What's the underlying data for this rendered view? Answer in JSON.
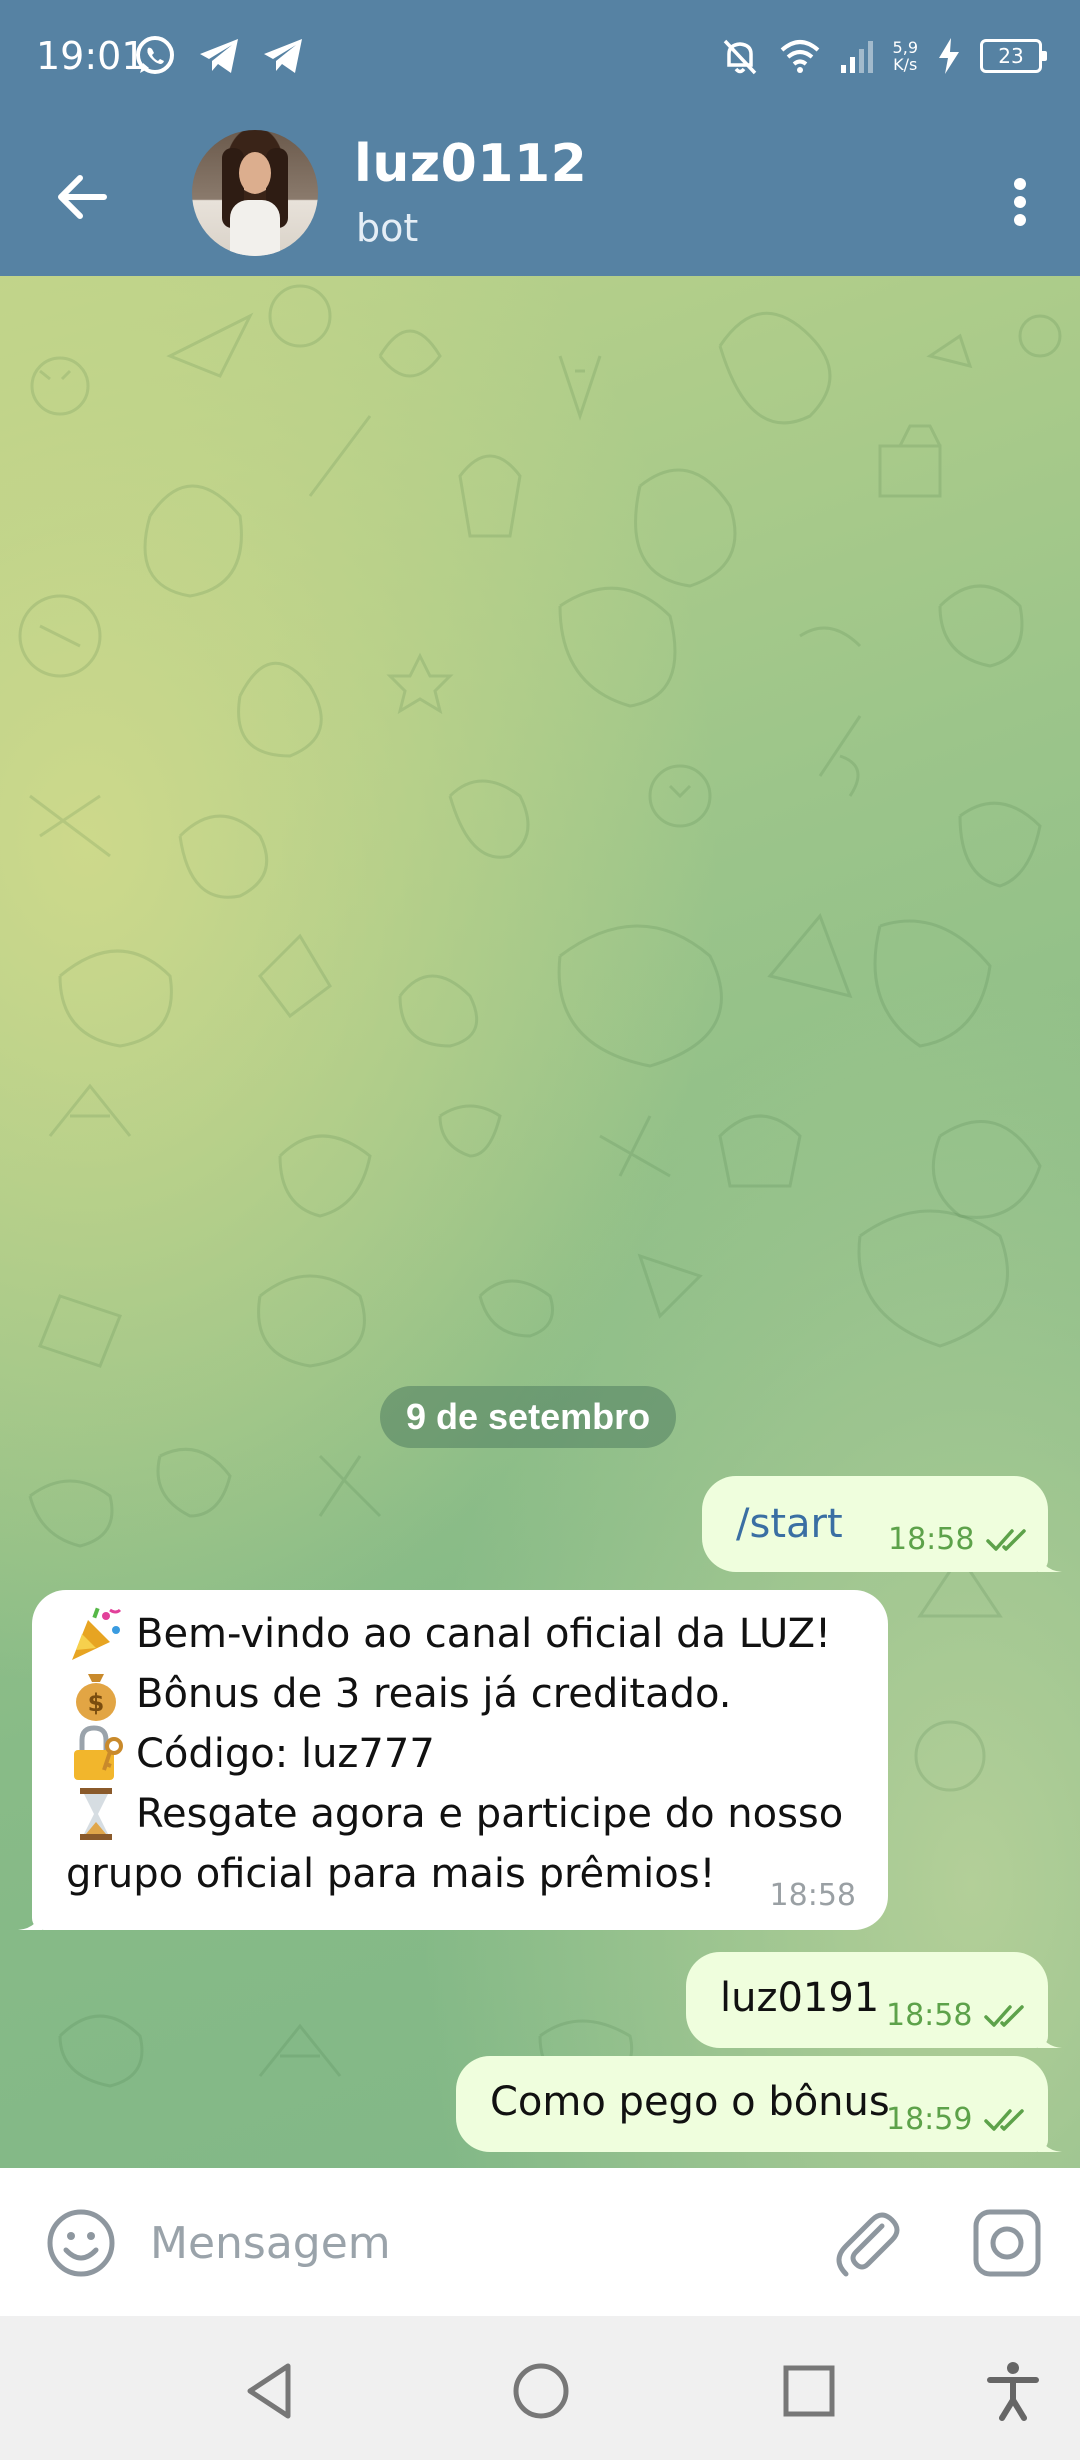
{
  "status_bar": {
    "time": "19:01",
    "app_icons": [
      "whatsapp-icon",
      "telegram-icon",
      "telegram-icon"
    ],
    "net_speed_value": "5,9",
    "net_speed_unit": "K/s",
    "battery": "23"
  },
  "header": {
    "title": "luz0112",
    "subtitle": "bot"
  },
  "chat": {
    "date_separator": "9 de setembro",
    "messages": [
      {
        "direction": "out",
        "text": "/start",
        "time": "18:58",
        "status": "read"
      },
      {
        "direction": "in",
        "lines": [
          {
            "emoji": "party-popper",
            "text": "Bem-vindo ao canal oficial da LUZ!"
          },
          {
            "emoji": "money-bag",
            "text": "Bônus de 3 reais já creditado."
          },
          {
            "emoji": "lock-with-key",
            "text": "Código: luz777"
          },
          {
            "emoji": "hourglass",
            "text": "Resgate agora e participe do nosso"
          },
          {
            "emoji": "",
            "text": "grupo oficial para mais prêmios!"
          }
        ],
        "time": "18:58"
      },
      {
        "direction": "out",
        "text": "luz0191",
        "time": "18:58",
        "status": "read"
      },
      {
        "direction": "out",
        "text": "Como pego o bônus",
        "time": "18:59",
        "status": "read"
      }
    ],
    "colors": {
      "outgoing_bubble": "#effedd",
      "incoming_bubble": "#ffffff",
      "time_outgoing": "#5da24a",
      "header": "#5682a3"
    }
  },
  "input": {
    "placeholder": "Mensagem"
  },
  "nav": {
    "buttons": [
      "back-triangle-icon",
      "home-circle-icon",
      "recents-square-icon",
      "accessibility-icon"
    ]
  }
}
